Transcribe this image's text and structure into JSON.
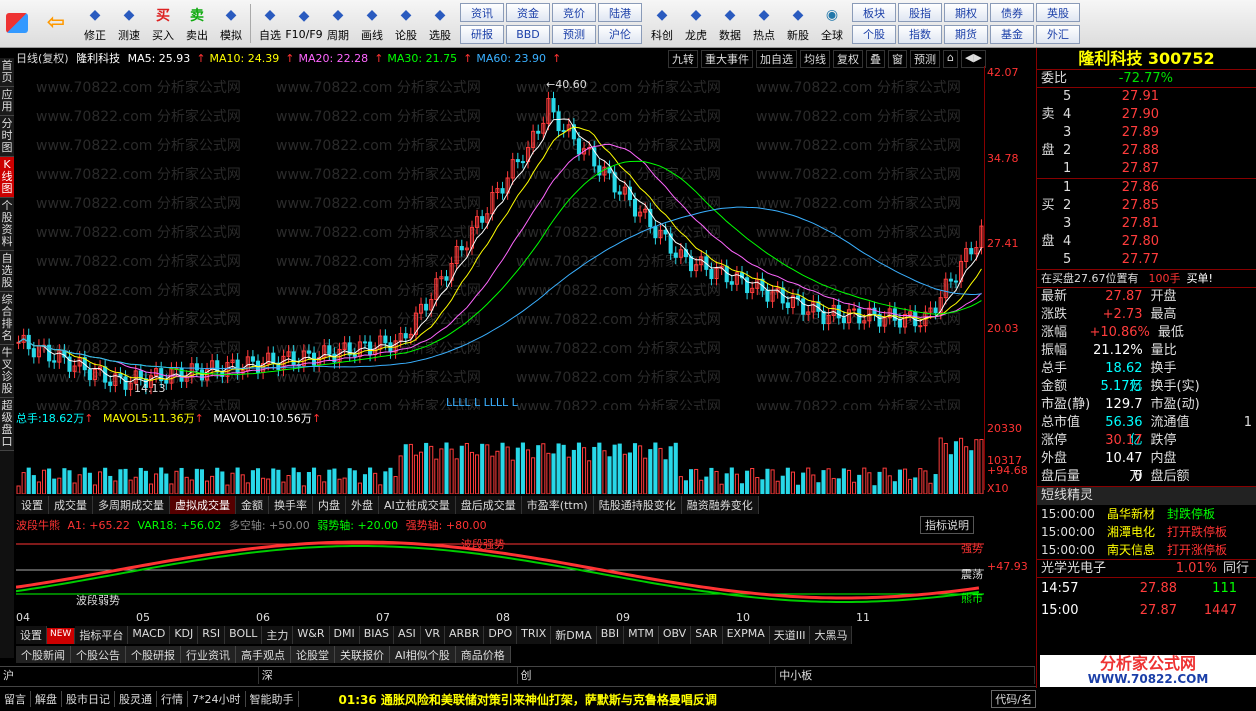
{
  "toolbar": {
    "buttons": [
      {
        "label": "修正",
        "icon": "up-arrow-icon"
      },
      {
        "label": "测速",
        "icon": "speedometer-icon"
      },
      {
        "label": "买入",
        "icon": "buy-icon",
        "glyph": "买"
      },
      {
        "label": "卖出",
        "icon": "sell-icon",
        "glyph": "卖"
      },
      {
        "label": "模拟",
        "icon": "hammer-icon"
      },
      {
        "label": "自选",
        "icon": "folder-icon"
      },
      {
        "label": "F10/F9",
        "icon": "f10-icon"
      },
      {
        "label": "周期",
        "icon": "cycle-icon"
      },
      {
        "label": "画线",
        "icon": "pencil-icon"
      },
      {
        "label": "论股",
        "icon": "discuss-icon"
      },
      {
        "label": "选股",
        "icon": "select-stock-icon"
      }
    ],
    "grp1": [
      "资讯",
      "研报",
      "资金",
      "BBD",
      "竞价",
      "预测",
      "陆港",
      "沪伦"
    ],
    "buttons2": [
      {
        "label": "科创"
      },
      {
        "label": "龙虎"
      },
      {
        "label": "数据"
      },
      {
        "label": "热点"
      },
      {
        "label": "新股"
      }
    ],
    "grp2": [
      "全球"
    ],
    "grp3": [
      "板块",
      "个股",
      "股指",
      "指数",
      "期权",
      "期货",
      "债券",
      "基金",
      "英股",
      "外汇"
    ]
  },
  "lefttabs": [
    "首页",
    "应用",
    "分时图",
    "K线图",
    "个股资料",
    "自选股",
    "综合排名",
    "牛叉诊股",
    "超级盘口"
  ],
  "chart": {
    "period": "日线(复权)",
    "name": "隆利科技",
    "ma": [
      {
        "label": "MA5:",
        "value": "25.93",
        "color": "#ffffff"
      },
      {
        "label": "MA10:",
        "value": "24.39",
        "color": "#ffff00"
      },
      {
        "label": "MA20:",
        "value": "22.28",
        "color": "#ff66ff"
      },
      {
        "label": "MA30:",
        "value": "21.75",
        "color": "#00ff00"
      },
      {
        "label": "MA60:",
        "value": "23.90",
        "color": "#3ab0ff"
      }
    ],
    "tools": [
      "九转",
      "重大事件",
      "加自选",
      "均线",
      "复权",
      "叠",
      "窗",
      "预测",
      "⌂",
      "◀▶"
    ],
    "hi_label": "40.60",
    "lo_label": "14.13",
    "yticks": [
      "42.07",
      "34.78",
      "27.41",
      "20.03"
    ],
    "watermark": "www.70822.com 分析家公式网",
    "signal_text": "LLLL  L  LLLL  L"
  },
  "vol": {
    "total_label": "总手:",
    "total": "18.62万",
    "mavol5_label": "MAVOL5:",
    "mavol5": "11.36万",
    "mavol10_label": "MAVOL10:",
    "mavol10": "10.56万",
    "yticks": [
      "20330",
      "10317",
      "X10"
    ]
  },
  "voltabs": [
    "设置",
    "成交量",
    "多周期成交量",
    "虚拟成交量",
    "金额",
    "换手率",
    "内盘",
    "外盘",
    "AI立桩成交量",
    "盘后成交量",
    "市盈率(ttm)",
    "陆股通持股变化",
    "融资融券变化"
  ],
  "ind": {
    "name": "波段牛熊",
    "a1": "A1: +65.22",
    "var18": "VAR18: +56.02",
    "dk": "多空轴: +50.00",
    "rs": "弱势轴: +20.00",
    "qs": "强势轴: +80.00",
    "btn": "指标说明",
    "yticks": [
      "+94.68",
      "+47.93"
    ],
    "labels": [
      "波段强势",
      "强势",
      "震荡",
      "熊市",
      "波段弱势"
    ]
  },
  "xaxis": [
    "04",
    "05",
    "06",
    "07",
    "08",
    "09",
    "10",
    "11"
  ],
  "indtabs": [
    "设置",
    "NEW",
    "指标平台",
    "MACD",
    "KDJ",
    "RSI",
    "BOLL",
    "主力",
    "W&R",
    "DMI",
    "BIAS",
    "ASI",
    "VR",
    "ARBR",
    "DPO",
    "TRIX",
    "新DMA",
    "BBI",
    "MTM",
    "OBV",
    "SAR",
    "EXPMA",
    "天道III",
    "大黑马"
  ],
  "navtabs": [
    "个股新闻",
    "个股公告",
    "个股研报",
    "行业资讯",
    "高手观点",
    "论股堂",
    "关联报价",
    "AI相似个股",
    "商品价格"
  ],
  "market": [
    "沪",
    "深",
    "创",
    "中小板"
  ],
  "bottom": {
    "items": [
      "留言",
      "解盘",
      "股市日记",
      "股灵通",
      "行情",
      "7*24小时",
      "智能助手"
    ],
    "time": "01:36",
    "news": "通胀风险和美联储对策引来神仙打架，萨默斯与克鲁格曼唱反调",
    "right": "代码/名"
  },
  "rp": {
    "title": "隆利科技 300752",
    "wb_label": "委比",
    "wb": "-72.77%",
    "sell_label": "卖盘",
    "buy_label": "买盘",
    "sells": [
      {
        "n": "5",
        "p": "27.91"
      },
      {
        "n": "4",
        "p": "27.90"
      },
      {
        "n": "3",
        "p": "27.89"
      },
      {
        "n": "2",
        "p": "27.88"
      },
      {
        "n": "1",
        "p": "27.87"
      }
    ],
    "buys": [
      {
        "n": "1",
        "p": "27.86"
      },
      {
        "n": "2",
        "p": "27.85"
      },
      {
        "n": "3",
        "p": "27.81"
      },
      {
        "n": "4",
        "p": "27.80"
      },
      {
        "n": "5",
        "p": "27.77"
      }
    ],
    "buyline": "在买盘27.67位置有",
    "buyline_val": "100手",
    "buyline_end": "买单!",
    "stats": [
      [
        "最新",
        "27.87",
        "开盘",
        ""
      ],
      [
        "涨跌",
        "+2.73",
        "最高",
        ""
      ],
      [
        "涨幅",
        "+10.86%",
        "最低",
        ""
      ],
      [
        "振幅",
        "21.12%",
        "量比",
        ""
      ],
      [
        "总手",
        "18.62万",
        "换手",
        ""
      ],
      [
        "金额",
        "5.17亿",
        "换手(实)",
        ""
      ],
      [
        "市盈(静)",
        "129.7",
        "市盈(动)",
        ""
      ],
      [
        "总市值",
        "56.36亿",
        "流通值",
        "1"
      ],
      [
        "涨停",
        "30.17",
        "跌停",
        ""
      ],
      [
        "外盘",
        "10.47万",
        "内盘",
        ""
      ],
      [
        "盘后量",
        "0",
        "盘后额",
        ""
      ]
    ],
    "sprite_title": "短线精灵",
    "sprites": [
      {
        "t": "15:00:00",
        "n": "晶华新材",
        "e": "封跌停板"
      },
      {
        "t": "15:00:00",
        "n": "湘潭电化",
        "e": "打开跌停板"
      },
      {
        "t": "15:00:00",
        "n": "南天信息",
        "e": "打开涨停板"
      }
    ],
    "sector": "光学光电子",
    "sector_pct": "1.01%",
    "sector_right": "同行",
    "ticks": [
      {
        "t": "14:57",
        "p": "27.88",
        "v": "111"
      },
      {
        "t": "15:00",
        "p": "27.87",
        "v": "1447"
      }
    ]
  },
  "ad": {
    "brand": "分析家公式网",
    "url": "WWW.70822.COM"
  }
}
